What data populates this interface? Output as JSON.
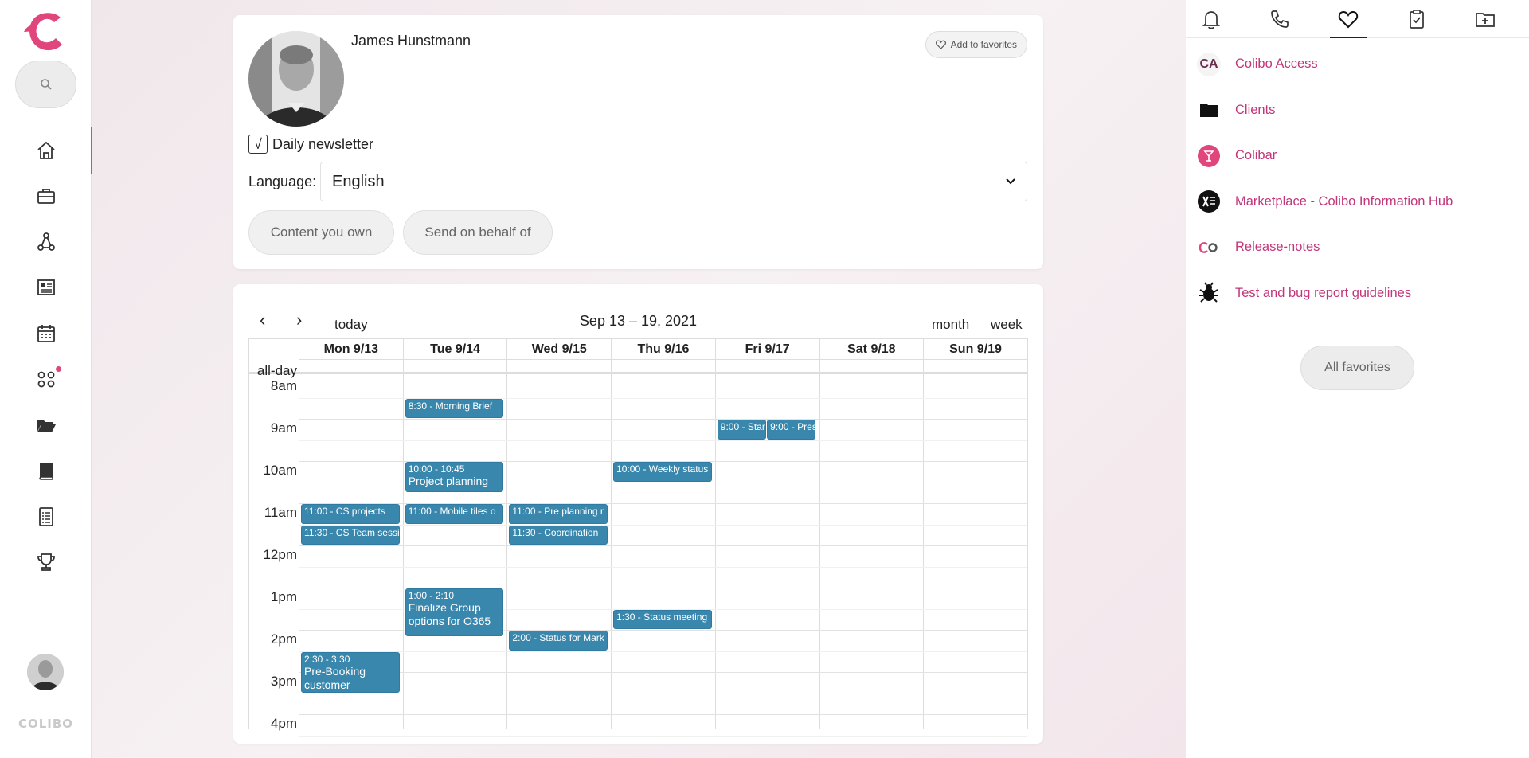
{
  "brand": {
    "name": "COLIBO",
    "accent": "#e0457b"
  },
  "search": {
    "icon": "search-icon"
  },
  "nav": [
    {
      "icon": "home-icon"
    },
    {
      "icon": "briefcase-icon"
    },
    {
      "icon": "network-icon"
    },
    {
      "icon": "news-icon"
    },
    {
      "icon": "calendar-icon"
    },
    {
      "icon": "apps-icon"
    },
    {
      "icon": "folder-icon"
    },
    {
      "icon": "book-icon"
    },
    {
      "icon": "document-icon"
    },
    {
      "icon": "trophy-icon"
    }
  ],
  "profile": {
    "name": "James Hunstmann",
    "add_to_favorites": "Add to favorites",
    "newsletter_label": "Daily newsletter",
    "newsletter_checked": true,
    "newsletter_check_glyph": "√",
    "language_label": "Language:",
    "language_value": "English",
    "content_you_own": "Content you own",
    "send_on_behalf": "Send on behalf of"
  },
  "calendar": {
    "range_title": "Sep 13 – 19, 2021",
    "prev": "‹",
    "next": "›",
    "today": "today",
    "month": "month",
    "week": "week",
    "allday_label": "all-day",
    "days": [
      "Mon 9/13",
      "Tue 9/14",
      "Wed 9/15",
      "Thu 9/16",
      "Fri 9/17",
      "Sat 9/18",
      "Sun 9/19"
    ],
    "times": [
      "8am",
      "9am",
      "10am",
      "11am",
      "12pm",
      "1pm",
      "2pm",
      "3pm",
      "4pm"
    ],
    "events": [
      {
        "day": 1,
        "start": 8.5,
        "end": 9.0,
        "time": "8:30 - Morning Brief",
        "title": ""
      },
      {
        "day": 4,
        "start": 9.0,
        "end": 9.5,
        "time": "9:00 - Stan",
        "title": ""
      },
      {
        "day": 4,
        "start": 9.0,
        "end": 9.5,
        "time": "9:00 - Pres",
        "title": ""
      },
      {
        "day": 1,
        "start": 10.0,
        "end": 10.75,
        "time": "10:00 - 10:45",
        "title": "Project planning"
      },
      {
        "day": 3,
        "start": 10.0,
        "end": 10.5,
        "time": "10:00 - Weekly status",
        "title": ""
      },
      {
        "day": 0,
        "start": 11.0,
        "end": 11.5,
        "time": "11:00 - CS projects",
        "title": ""
      },
      {
        "day": 0,
        "start": 11.5,
        "end": 12.0,
        "time": "11:30 - CS Team sessi",
        "title": ""
      },
      {
        "day": 1,
        "start": 11.0,
        "end": 11.5,
        "time": "11:00 - Mobile tiles o",
        "title": ""
      },
      {
        "day": 2,
        "start": 11.0,
        "end": 11.5,
        "time": "11:00 - Pre planning r",
        "title": ""
      },
      {
        "day": 2,
        "start": 11.5,
        "end": 12.0,
        "time": "11:30 - Coordination",
        "title": ""
      },
      {
        "day": 1,
        "start": 13.0,
        "end": 14.17,
        "time": "1:00 - 2:10",
        "title": "Finalize Group options for O365"
      },
      {
        "day": 3,
        "start": 13.5,
        "end": 14.0,
        "time": "1:30 - Status meeting",
        "title": ""
      },
      {
        "day": 2,
        "start": 14.0,
        "end": 14.5,
        "time": "2:00 - Status for Mark",
        "title": ""
      },
      {
        "day": 0,
        "start": 14.5,
        "end": 15.5,
        "time": "2:30 - 3:30",
        "title": "Pre-Booking customer"
      }
    ],
    "event_color": "#3a87ad"
  },
  "right_panel": {
    "tabs": [
      {
        "icon": "bell-icon"
      },
      {
        "icon": "phone-icon"
      },
      {
        "icon": "heart-icon",
        "active": true
      },
      {
        "icon": "clipboard-check-icon"
      },
      {
        "icon": "folder-plus-icon"
      }
    ],
    "favorites": [
      {
        "label": "Colibo Access",
        "icon": "colibo-access-icon",
        "icon_text": "CA"
      },
      {
        "label": "Clients",
        "icon": "folder-icon"
      },
      {
        "label": "Colibar",
        "icon": "cocktail-icon"
      },
      {
        "label": "Marketplace - Colibo Information Hub",
        "icon": "excel-icon"
      },
      {
        "label": "Release-notes",
        "icon": "colibo-logo-icon"
      },
      {
        "label": "Test and bug report guidelines",
        "icon": "bug-icon"
      }
    ],
    "all_favorites": "All favorites",
    "link_color": "#c2367a"
  }
}
